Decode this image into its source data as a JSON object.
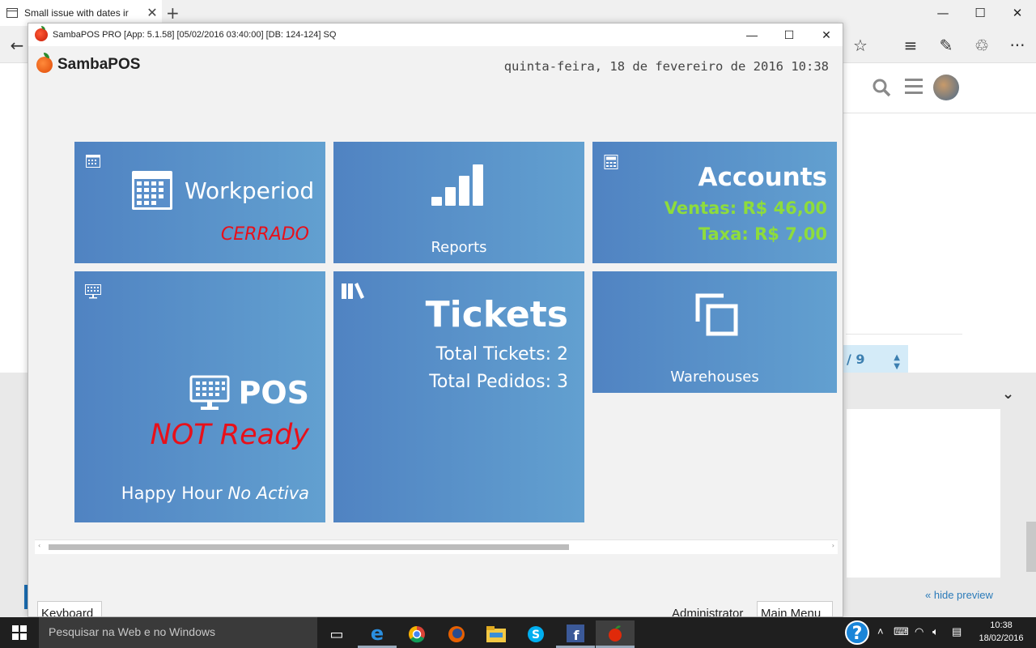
{
  "browser": {
    "tab_title": "Small issue with dates ir",
    "tab_close": "✕",
    "new_tab": "+",
    "min": "—",
    "max": "☐",
    "close": "✕"
  },
  "background_page": {
    "pager_text": "/ 9",
    "hide_preview": "« hide preview"
  },
  "app": {
    "window_title": "SambaPOS PRO [App: 5.1.58] [05/02/2016 03:40:00] [DB: 124-124] SQ",
    "logo_text": "SambaPOS",
    "datetime": "quinta-feira, 18 de fevereiro de 2016 10:38",
    "tiles": {
      "workperiod": {
        "label": "Workperiod",
        "status": "CERRADO"
      },
      "reports": {
        "label": "Reports"
      },
      "accounts": {
        "title": "Accounts",
        "line1": "Ventas: R$ 46,00",
        "line2": "Taxa: R$ 7,00"
      },
      "pos": {
        "title": "POS",
        "status": "NOT Ready",
        "happy_hour_prefix": "Happy Hour",
        "happy_hour_state": "No Activa"
      },
      "tickets": {
        "title": "Tickets",
        "line1": "Total Tickets: 2",
        "line2": "Total Pedidos: 3"
      },
      "warehouses": {
        "label": "Warehouses"
      }
    },
    "scroll_fraction": 0.0,
    "footer": {
      "keyboard": "Keyboard",
      "user": "Administrator",
      "main_menu": "Main Menu"
    }
  },
  "taskbar": {
    "search_placeholder": "Pesquisar na Web e no Windows",
    "help": "?",
    "clock_time": "10:38",
    "clock_date": "18/02/2016"
  },
  "colors": {
    "tile_gradient_start": "#5083c2",
    "tile_gradient_end": "#62a0d0",
    "status_red": "#e8101a",
    "accounts_green": "#8edc3c"
  }
}
